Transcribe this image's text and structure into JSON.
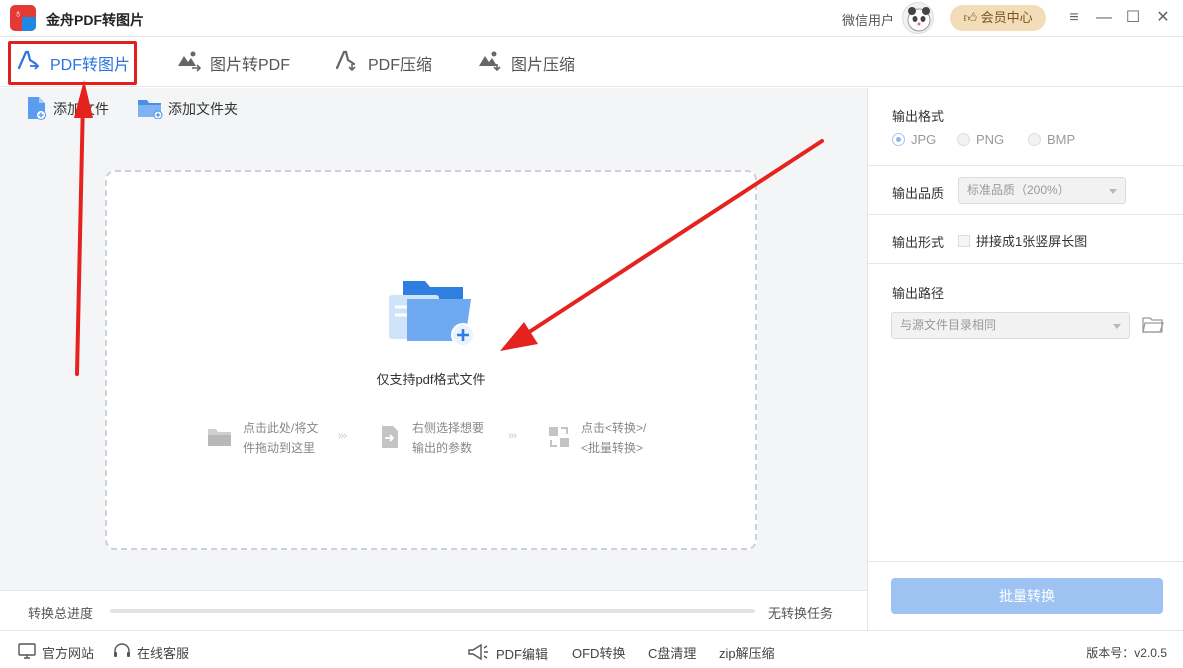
{
  "app": {
    "title": "金舟PDF转图片"
  },
  "user": {
    "name": "微信用户",
    "vip_label": "会员中心"
  },
  "window_controls": {
    "menu": "≡",
    "minimize": "—",
    "maximize": "☐",
    "close": "✕"
  },
  "tabs": [
    {
      "label": "PDF转图片",
      "icon": "pdf-to-image-icon",
      "active": true
    },
    {
      "label": "图片转PDF",
      "icon": "image-to-pdf-icon",
      "active": false
    },
    {
      "label": "PDF压缩",
      "icon": "pdf-compress-icon",
      "active": false
    },
    {
      "label": "图片压缩",
      "icon": "image-compress-icon",
      "active": false
    }
  ],
  "toolbar": {
    "add_file": "添加文件",
    "add_folder": "添加文件夹"
  },
  "dropzone": {
    "hint": "仅支持pdf格式文件",
    "steps": [
      {
        "text": "点击此处/将文\n件拖动到这里",
        "icon": "folder-icon"
      },
      {
        "text": "右侧选择想要\n输出的参数",
        "icon": "arrow-into-box-icon"
      },
      {
        "text": "点击<转换>/\n<批量转换>",
        "icon": "convert-icon"
      }
    ],
    "separator": "›››"
  },
  "progress": {
    "label": "转换总进度",
    "status": "无转换任务",
    "value": 0
  },
  "settings": {
    "format": {
      "title": "输出格式",
      "options": [
        "JPG",
        "PNG",
        "BMP"
      ],
      "selected": "JPG"
    },
    "quality": {
      "title": "输出品质",
      "value": "标准品质（200%）"
    },
    "form": {
      "title": "输出形式",
      "checkbox_label": "拼接成1张竖屏长图",
      "checked": false
    },
    "path": {
      "title": "输出路径",
      "value": "与源文件目录相同"
    },
    "batch_button": "批量转换"
  },
  "footer": {
    "links": [
      "官方网站",
      "在线客服"
    ],
    "tools": [
      "PDF编辑",
      "OFD转换",
      "C盘清理",
      "zip解压缩"
    ],
    "version": "版本号：v2.0.5"
  },
  "colors": {
    "accent": "#2b73e0",
    "highlight_red": "#e02020",
    "vip_bg": "#f3dcb8"
  }
}
